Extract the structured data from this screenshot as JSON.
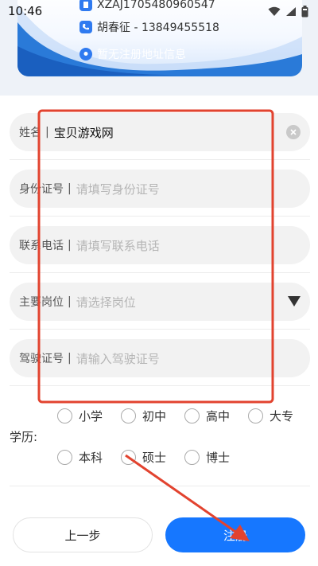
{
  "status_bar": {
    "time": "10:46"
  },
  "card": {
    "code": "XZAJ1705480960547",
    "contact": "胡春征 - 13849455518",
    "address": "暂无注册地址信息"
  },
  "form": {
    "name": {
      "label": "姓名",
      "separator": "|",
      "value": "宝贝游戏网"
    },
    "id_card": {
      "label": "身份证号",
      "separator": "|",
      "placeholder": "请填写身份证号"
    },
    "phone": {
      "label": "联系电话",
      "separator": "|",
      "placeholder": "请填写联系电话"
    },
    "position": {
      "label": "主要岗位",
      "separator": "|",
      "placeholder": "请选择岗位"
    },
    "license": {
      "label": "驾驶证号",
      "separator": "|",
      "placeholder": "请输入驾驶证号"
    }
  },
  "education": {
    "label": "学历:",
    "options": [
      "小学",
      "初中",
      "高中",
      "大专",
      "本科",
      "硕士",
      "博士"
    ]
  },
  "buttons": {
    "prev": "上一步",
    "submit": "注册"
  },
  "colors": {
    "accent": "#1677ff",
    "annotation": "#e2432f"
  }
}
